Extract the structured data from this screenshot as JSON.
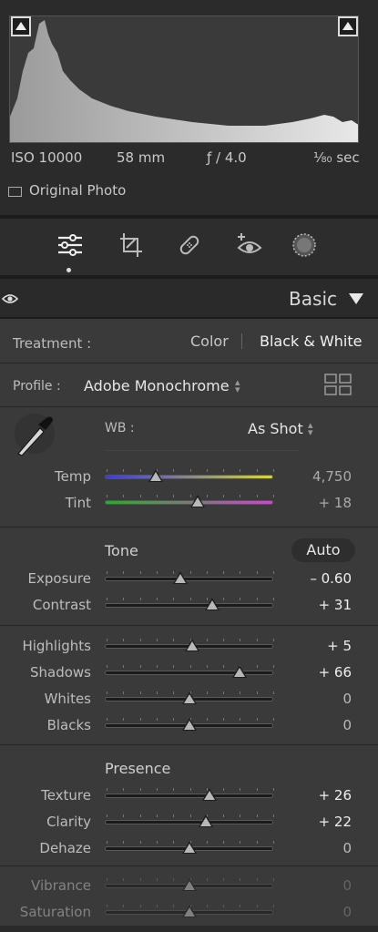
{
  "histogram": {
    "iso": "ISO 10000",
    "focal": "58 mm",
    "aperture": "ƒ / 4.0",
    "shutter": "⅟₈₀ sec",
    "original_photo": "Original Photo"
  },
  "tools": [
    "edit-sliders-icon",
    "crop-icon",
    "healing-bandage-icon",
    "red-eye-icon",
    "masking-icon"
  ],
  "header": {
    "title": "Basic"
  },
  "treatment": {
    "label": "Treatment :",
    "color": "Color",
    "bw": "Black & White"
  },
  "profile": {
    "label": "Profile :",
    "value": "Adobe Monochrome"
  },
  "wb": {
    "label": "WB :",
    "value": "As Shot"
  },
  "temp": {
    "label": "Temp",
    "value": "4,750",
    "pos": 0.3
  },
  "tint": {
    "label": "Tint",
    "value": "+ 18",
    "pos": 0.55
  },
  "tone": {
    "title": "Tone",
    "auto": "Auto"
  },
  "sliders": {
    "exposure": {
      "label": "Exposure",
      "value": "– 0.60",
      "pos": 0.45
    },
    "contrast": {
      "label": "Contrast",
      "value": "+ 31",
      "pos": 0.64
    },
    "highlights": {
      "label": "Highlights",
      "value": "+ 5",
      "pos": 0.52
    },
    "shadows": {
      "label": "Shadows",
      "value": "+ 66",
      "pos": 0.8
    },
    "whites": {
      "label": "Whites",
      "value": "0",
      "pos": 0.5
    },
    "blacks": {
      "label": "Blacks",
      "value": "0",
      "pos": 0.5
    },
    "texture": {
      "label": "Texture",
      "value": "+ 26",
      "pos": 0.62
    },
    "clarity": {
      "label": "Clarity",
      "value": "+ 22",
      "pos": 0.6
    },
    "dehaze": {
      "label": "Dehaze",
      "value": "0",
      "pos": 0.5
    },
    "vibrance": {
      "label": "Vibrance",
      "value": "0",
      "pos": 0.5
    },
    "saturation": {
      "label": "Saturation",
      "value": "0",
      "pos": 0.5
    }
  },
  "presence": {
    "title": "Presence"
  }
}
